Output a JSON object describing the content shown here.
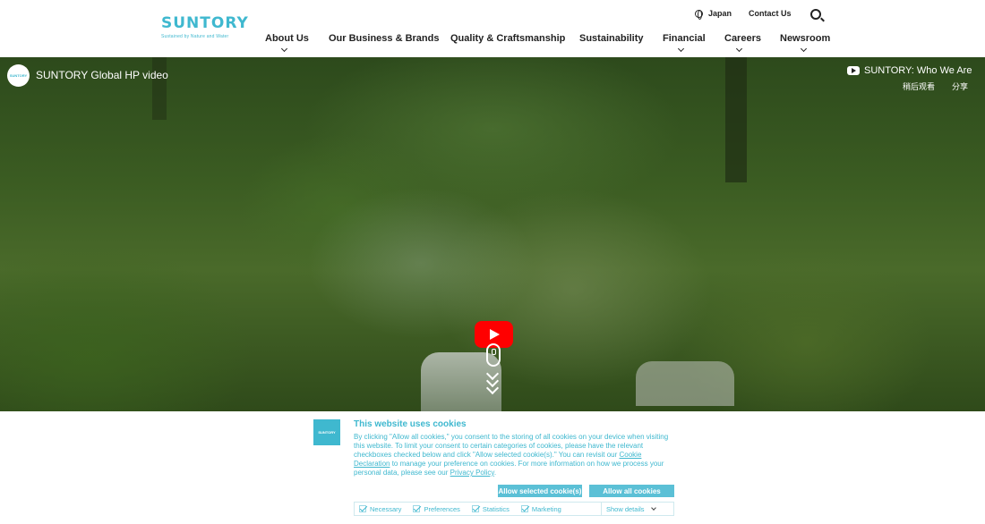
{
  "header": {
    "logo_word": "SUNTORY",
    "logo_tagline": "Sustained by Nature and Water",
    "util_lang": "Japan",
    "util_contact": "Contact Us",
    "nav": [
      {
        "label": "About Us",
        "has_dropdown": true
      },
      {
        "label": "Our Business & Brands",
        "has_dropdown": false
      },
      {
        "label": "Quality & Craftsmanship",
        "has_dropdown": false
      },
      {
        "label": "Sustainability",
        "has_dropdown": false
      },
      {
        "label": "Financial",
        "has_dropdown": true
      },
      {
        "label": "Careers",
        "has_dropdown": true
      },
      {
        "label": "Newsroom",
        "has_dropdown": true
      }
    ]
  },
  "video": {
    "channel_logo_text": "SUNTORY",
    "title": "SUNTORY Global HP video",
    "right_title": "SUNTORY: Who We Are",
    "watch_later": "稍后观看",
    "share": "分享"
  },
  "cookie": {
    "logo_text": "SUNTORY",
    "title": "This website uses cookies",
    "body_part1": "By clicking \"Allow all cookies,\" you consent to the storing of all cookies on your device when visiting this website. To limit your consent to certain categories of cookies, please have the relevant checkboxes checked below and click \"Allow selected cookie(s).\" You can revisit our ",
    "link_cookie": "Cookie Declaration",
    "body_part2": " to manage your preference on cookies.  For more information on how we process your personal data, please see our ",
    "link_privacy": "Privacy Policy",
    "body_part3": ".",
    "btn_selected": "Allow selected cookie(s)",
    "btn_all": "Allow all cookies",
    "prefs": [
      "Necessary",
      "Preferences",
      "Statistics",
      "Marketing"
    ],
    "show_details": "Show details"
  },
  "colors": {
    "brand": "#3fb8cf",
    "button": "#5bc0d6",
    "play": "#ff0000"
  }
}
